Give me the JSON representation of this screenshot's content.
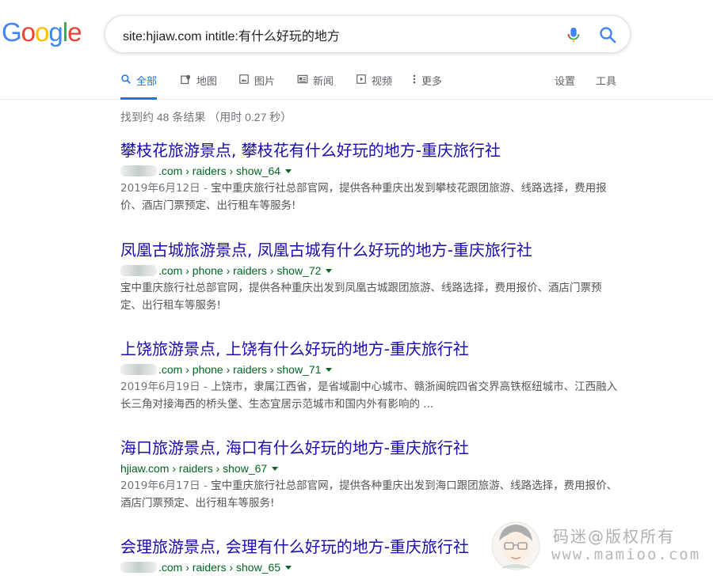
{
  "logo": {
    "letters": [
      {
        "char": "G",
        "color": "#4285F4"
      },
      {
        "char": "o",
        "color": "#EA4335"
      },
      {
        "char": "o",
        "color": "#FBBC05"
      },
      {
        "char": "g",
        "color": "#4285F4"
      },
      {
        "char": "l",
        "color": "#34A853"
      },
      {
        "char": "e",
        "color": "#EA4335"
      }
    ]
  },
  "search": {
    "query": "site:hjiaw.com intitle:有什么好玩的地方"
  },
  "tabs": [
    {
      "label": "全部",
      "icon": "search-icon",
      "active": true
    },
    {
      "label": "地图",
      "icon": "map-icon"
    },
    {
      "label": "图片",
      "icon": "image-icon"
    },
    {
      "label": "新闻",
      "icon": "news-icon"
    },
    {
      "label": "视频",
      "icon": "video-icon"
    },
    {
      "label": "更多",
      "icon": "more-vert-icon"
    }
  ],
  "tools": {
    "settings": "设置",
    "tools": "工具"
  },
  "stats": "找到约 48 条结果 （用时 0.27 秒）",
  "results": [
    {
      "title": "攀枝花旅游景点, 攀枝花有什么好玩的地方-重庆旅行社",
      "url": ".com › raiders › show_64",
      "date": "2019年6月12日 - ",
      "snippet": "宝中重庆旅行社总部官网，提供各种重庆出发到攀枝花跟团旅游、线路选择，费用报价、酒店门票预定、出行租车等服务!"
    },
    {
      "title": "凤凰古城旅游景点, 凤凰古城有什么好玩的地方-重庆旅行社",
      "url": ".com › phone › raiders › show_72",
      "date": "",
      "snippet": "宝中重庆旅行社总部官网，提供各种重庆出发到凤凰古城跟团旅游、线路选择，费用报价、酒店门票预定、出行租车等服务!"
    },
    {
      "title": "上饶旅游景点, 上饶有什么好玩的地方-重庆旅行社",
      "url": ".com › phone › raiders › show_71",
      "date": "2019年6月19日 - ",
      "snippet": "上饶市，隶属江西省，是省域副中心城市、赣浙闽皖四省交界高铁枢纽城市、江西融入长三角对接海西的桥头堡、生态宜居示范城市和国内外有影响的 ..."
    },
    {
      "title": "海口旅游景点, 海口有什么好玩的地方-重庆旅行社",
      "url": "hjiaw.com › raiders › show_67",
      "date": "2019年6月17日 - ",
      "snippet": "宝中重庆旅行社总部官网，提供各种重庆出发到海口跟团旅游、线路选择，费用报价、酒店门票预定、出行租车等服务!"
    },
    {
      "title": "会理旅游景点, 会理有什么好玩的地方-重庆旅行社",
      "url": ".com › raiders › show_65",
      "date": "",
      "snippet": ""
    }
  ],
  "watermark": {
    "line1": "码迷@版权所有",
    "line2": "www.mamioo.com"
  },
  "colors": {
    "link": "#1a0dab",
    "url": "#006621",
    "accent": "#1a73e8"
  }
}
